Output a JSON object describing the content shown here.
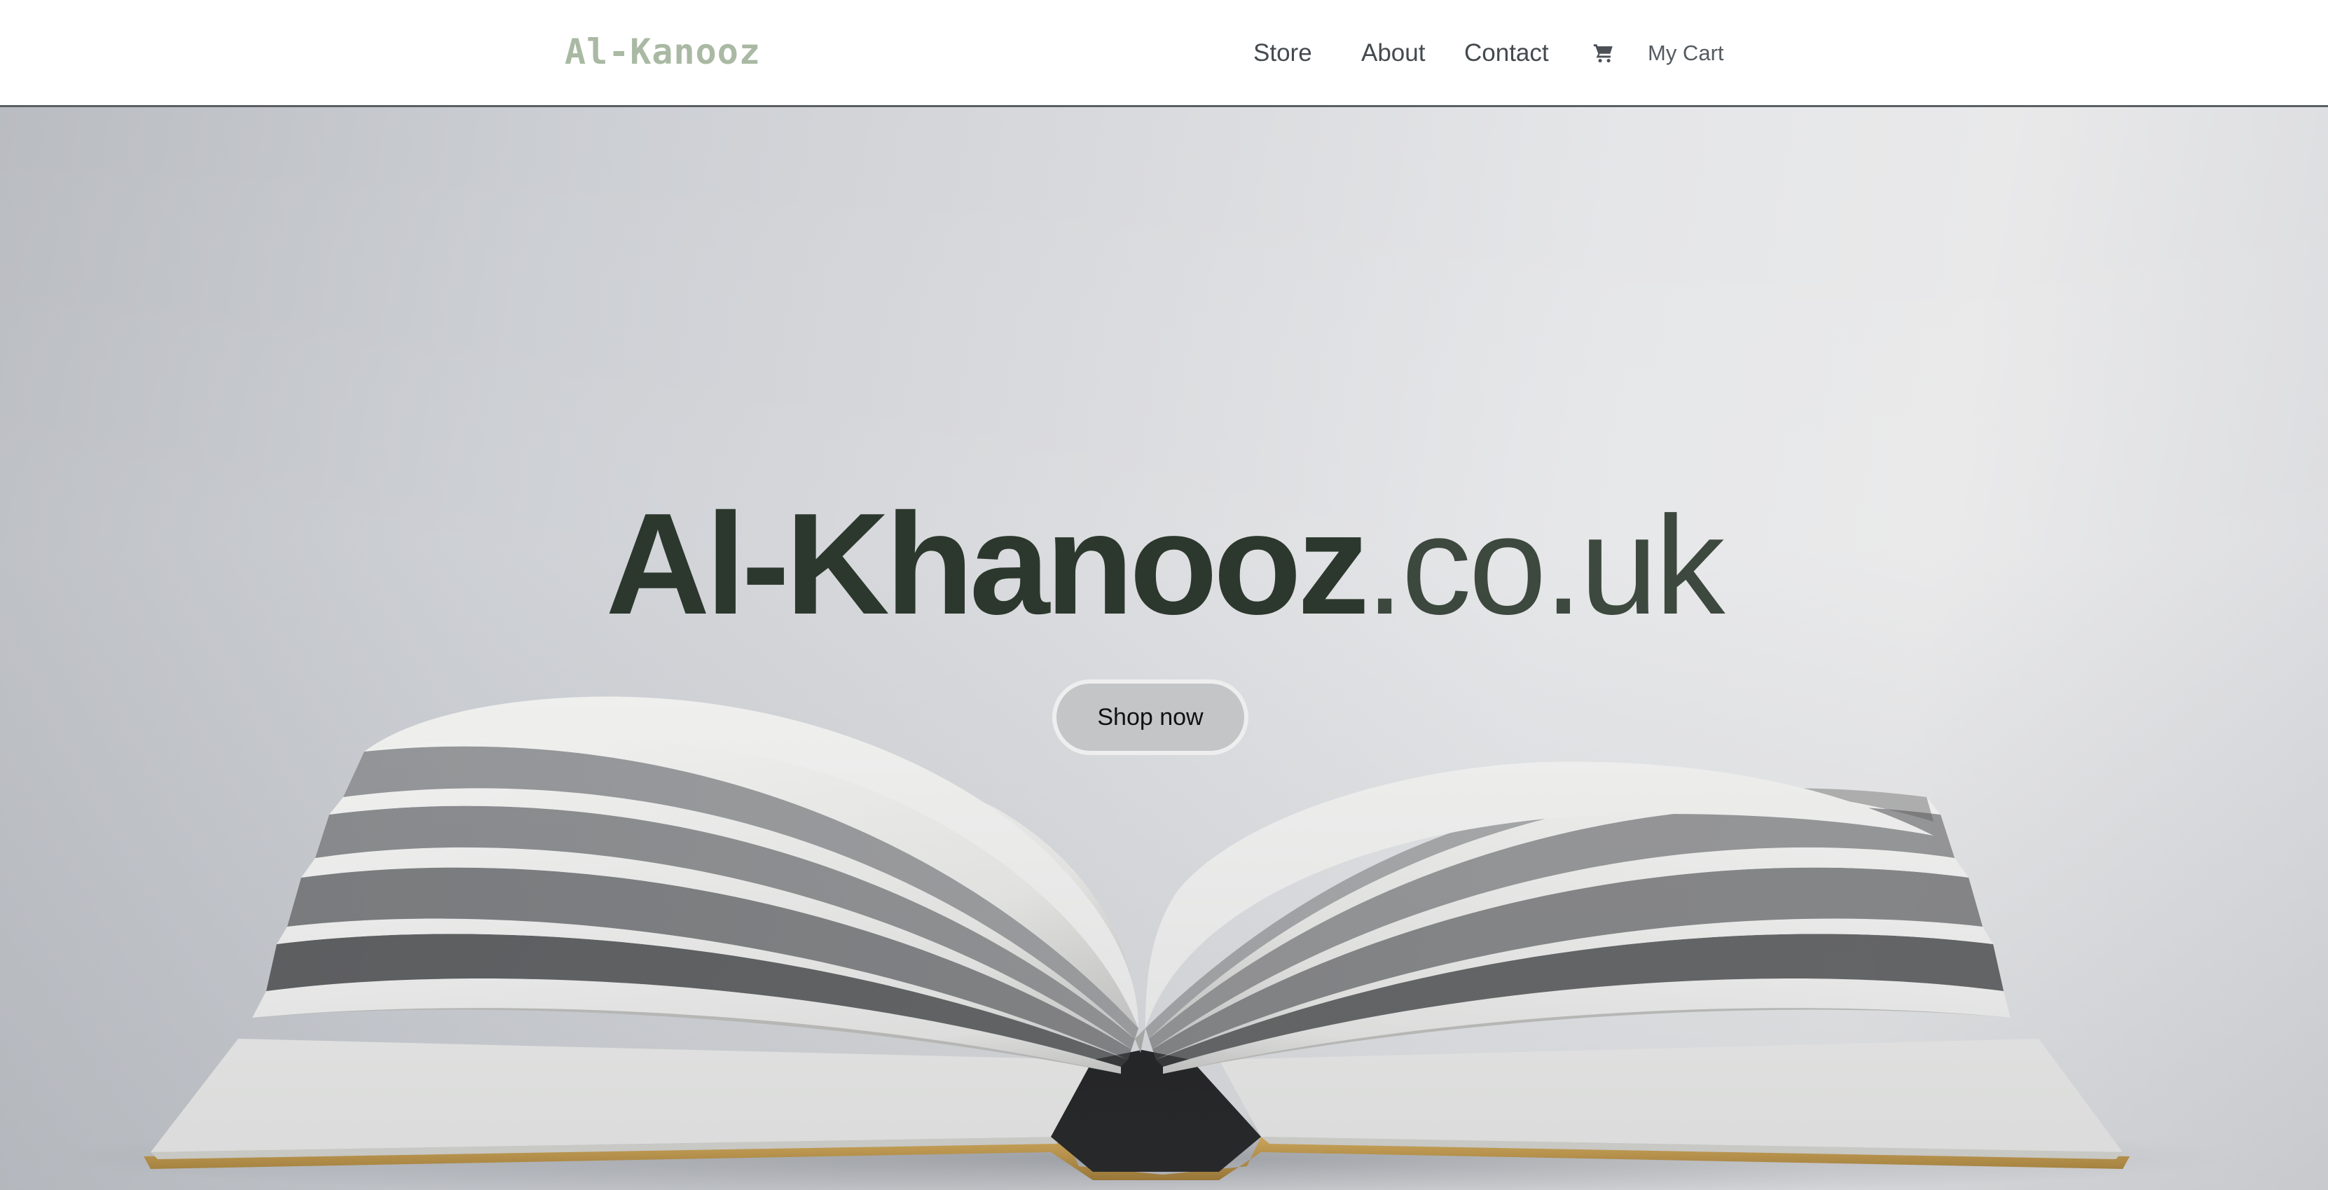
{
  "header": {
    "brand": "Al-Kanooz",
    "nav": {
      "store": "Store",
      "about": "About",
      "contact": "Contact"
    },
    "cart": {
      "icon": "cart-icon",
      "label": "My Cart"
    }
  },
  "hero": {
    "title_bold": "Al-Khanooz",
    "title_thin": ".co.uk",
    "cta_label": "Shop now",
    "image": "open-book-image"
  },
  "colors": {
    "brand": "#a9b9a3",
    "headline": "#2c382d",
    "button_bg": "#c4c5c7",
    "nav_text": "#444a4e",
    "header_border": "#585f63"
  }
}
